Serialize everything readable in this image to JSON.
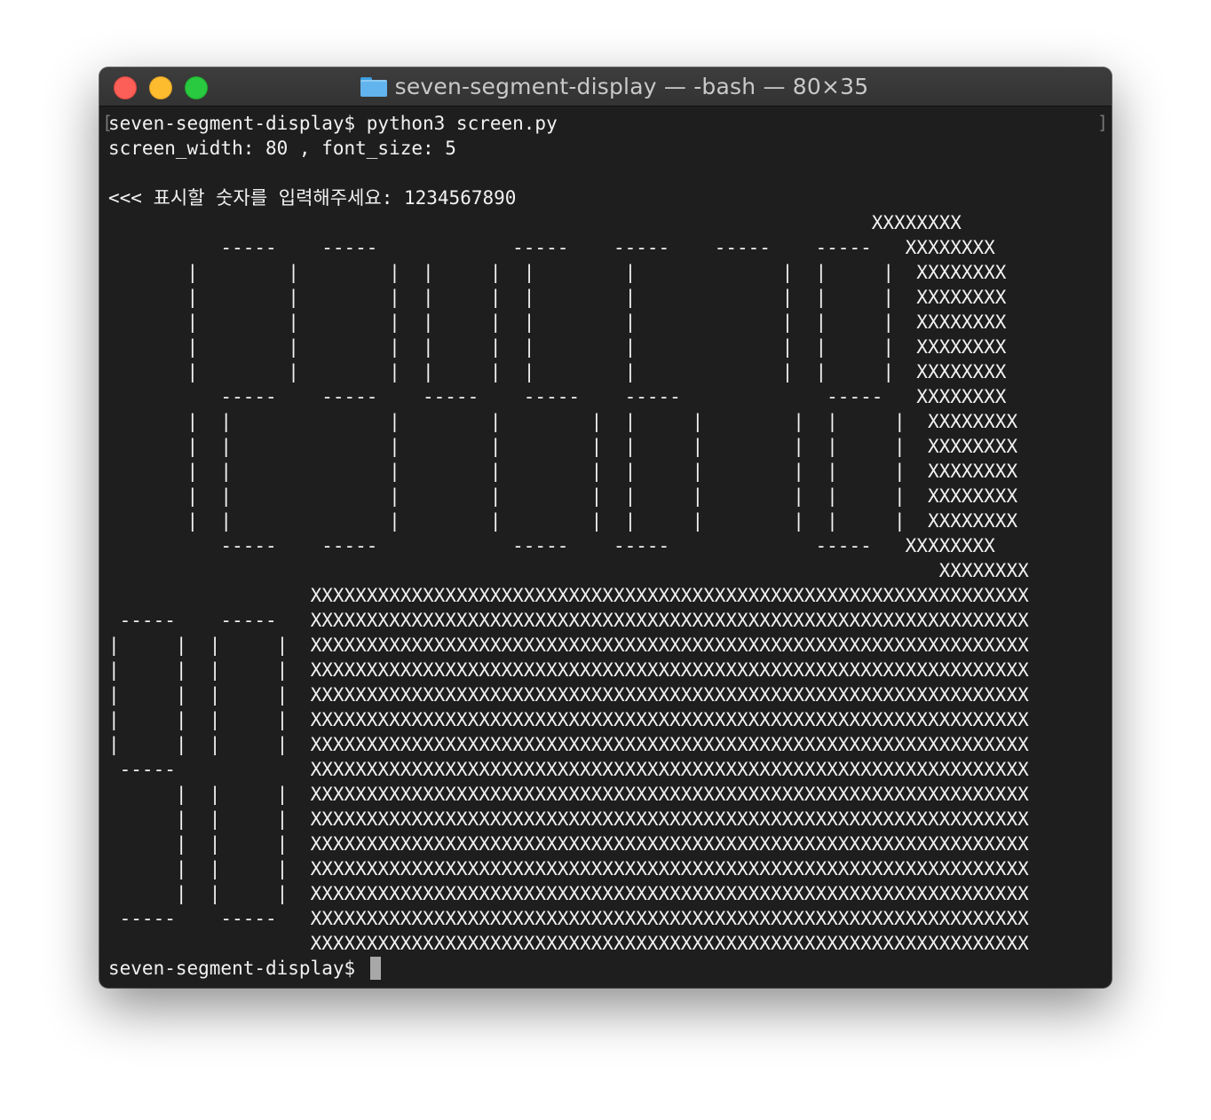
{
  "window": {
    "title": "seven-segment-display — -bash — 80×35",
    "icon": "folder-icon",
    "controls": [
      "close",
      "minimize",
      "zoom"
    ]
  },
  "terminal": {
    "lines": [
      "seven-segment-display$ python3 screen.py",
      "screen_width: 80 , font_size: 5",
      "",
      "<<< 표시할 숫자를 입력해주세요: 1234567890",
      "                                                                    XXXXXXXX",
      "          -----    -----            -----    -----    -----    -----   XXXXXXXX",
      "       |        |        |  |     |  |        |             |  |     |  XXXXXXXX",
      "       |        |        |  |     |  |        |             |  |     |  XXXXXXXX",
      "       |        |        |  |     |  |        |             |  |     |  XXXXXXXX",
      "       |        |        |  |     |  |        |             |  |     |  XXXXXXXX",
      "       |        |        |  |     |  |        |             |  |     |  XXXXXXXX",
      "          -----    -----    -----    -----    -----             -----   XXXXXXXX",
      "       |  |              |        |        |  |     |        |  |     |  XXXXXXXX",
      "       |  |              |        |        |  |     |        |  |     |  XXXXXXXX",
      "       |  |              |        |        |  |     |        |  |     |  XXXXXXXX",
      "       |  |              |        |        |  |     |        |  |     |  XXXXXXXX",
      "       |  |              |        |        |  |     |        |  |     |  XXXXXXXX",
      "          -----    -----            -----    -----             -----   XXXXXXXX",
      "                                                                          XXXXXXXX",
      "                  XXXXXXXXXXXXXXXXXXXXXXXXXXXXXXXXXXXXXXXXXXXXXXXXXXXXXXXXXXXXXXXX",
      " -----    -----   XXXXXXXXXXXXXXXXXXXXXXXXXXXXXXXXXXXXXXXXXXXXXXXXXXXXXXXXXXXXXXXX",
      "|     |  |     |  XXXXXXXXXXXXXXXXXXXXXXXXXXXXXXXXXXXXXXXXXXXXXXXXXXXXXXXXXXXXXXXX",
      "|     |  |     |  XXXXXXXXXXXXXXXXXXXXXXXXXXXXXXXXXXXXXXXXXXXXXXXXXXXXXXXXXXXXXXXX",
      "|     |  |     |  XXXXXXXXXXXXXXXXXXXXXXXXXXXXXXXXXXXXXXXXXXXXXXXXXXXXXXXXXXXXXXXX",
      "|     |  |     |  XXXXXXXXXXXXXXXXXXXXXXXXXXXXXXXXXXXXXXXXXXXXXXXXXXXXXXXXXXXXXXXX",
      "|     |  |     |  XXXXXXXXXXXXXXXXXXXXXXXXXXXXXXXXXXXXXXXXXXXXXXXXXXXXXXXXXXXXXXXX",
      " -----            XXXXXXXXXXXXXXXXXXXXXXXXXXXXXXXXXXXXXXXXXXXXXXXXXXXXXXXXXXXXXXXX",
      "      |  |     |  XXXXXXXXXXXXXXXXXXXXXXXXXXXXXXXXXXXXXXXXXXXXXXXXXXXXXXXXXXXXXXXX",
      "      |  |     |  XXXXXXXXXXXXXXXXXXXXXXXXXXXXXXXXXXXXXXXXXXXXXXXXXXXXXXXXXXXXXXXX",
      "      |  |     |  XXXXXXXXXXXXXXXXXXXXXXXXXXXXXXXXXXXXXXXXXXXXXXXXXXXXXXXXXXXXXXXX",
      "      |  |     |  XXXXXXXXXXXXXXXXXXXXXXXXXXXXXXXXXXXXXXXXXXXXXXXXXXXXXXXXXXXXXXXX",
      "      |  |     |  XXXXXXXXXXXXXXXXXXXXXXXXXXXXXXXXXXXXXXXXXXXXXXXXXXXXXXXXXXXXXXXX",
      " -----    -----   XXXXXXXXXXXXXXXXXXXXXXXXXXXXXXXXXXXXXXXXXXXXXXXXXXXXXXXXXXXXXXXX",
      "                  XXXXXXXXXXXXXXXXXXXXXXXXXXXXXXXXXXXXXXXXXXXXXXXXXXXXXXXXXXXXXXXX",
      "seven-segment-display$ "
    ]
  }
}
